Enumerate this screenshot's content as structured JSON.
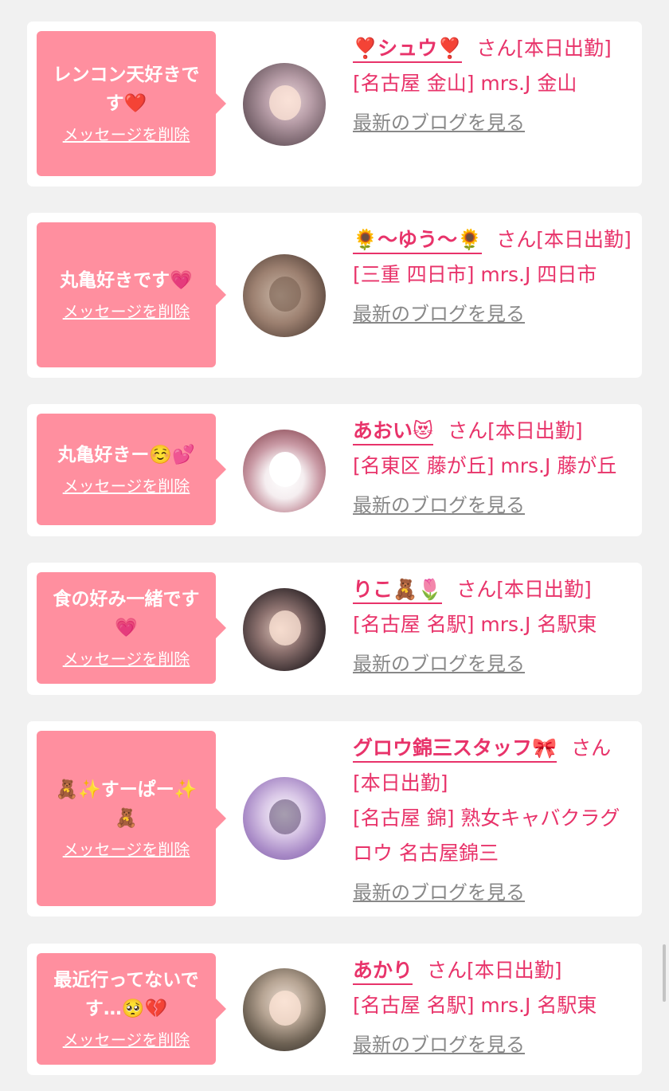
{
  "delete_label": "メッセージを削除",
  "blog_label": "最新のブログを見る",
  "suffix": "さん",
  "colors": {
    "background": "#f1f1f1",
    "card": "#ffffff",
    "bubble": "#ff8f9f",
    "accent": "#e8336a",
    "link_gray": "#888888"
  },
  "messages": [
    {
      "message": "レンコン天好きです❤️",
      "name": "❣️シュウ❣️",
      "status": "[本日出勤]",
      "location": "[名古屋 金山] mrs.J 金山"
    },
    {
      "message": "丸亀好きです💗",
      "name": "🌻〜ゆう〜🌻",
      "status": "[本日出勤]",
      "location": "[三重 四日市] mrs.J 四日市"
    },
    {
      "message": "丸亀好きー☺️💕",
      "name": "あおい😻",
      "status": "[本日出勤]",
      "location": "[名東区 藤が丘] mrs.J 藤が丘"
    },
    {
      "message": "食の好み一緒です💗",
      "name": "りこ🧸🌷",
      "status": "[本日出勤]",
      "location": "[名古屋 名駅] mrs.J 名駅東"
    },
    {
      "message": "🧸✨すーぱー✨🧸",
      "name": "グロウ錦三スタッフ🎀",
      "status": "[本日出勤]",
      "location": "[名古屋 錦] 熟女キャバクラグロウ 名古屋錦三"
    },
    {
      "message": "最近行ってないです…🥺💔",
      "name": "あかり",
      "status": "[本日出勤]",
      "location": "[名古屋 名駅] mrs.J 名駅東"
    }
  ]
}
